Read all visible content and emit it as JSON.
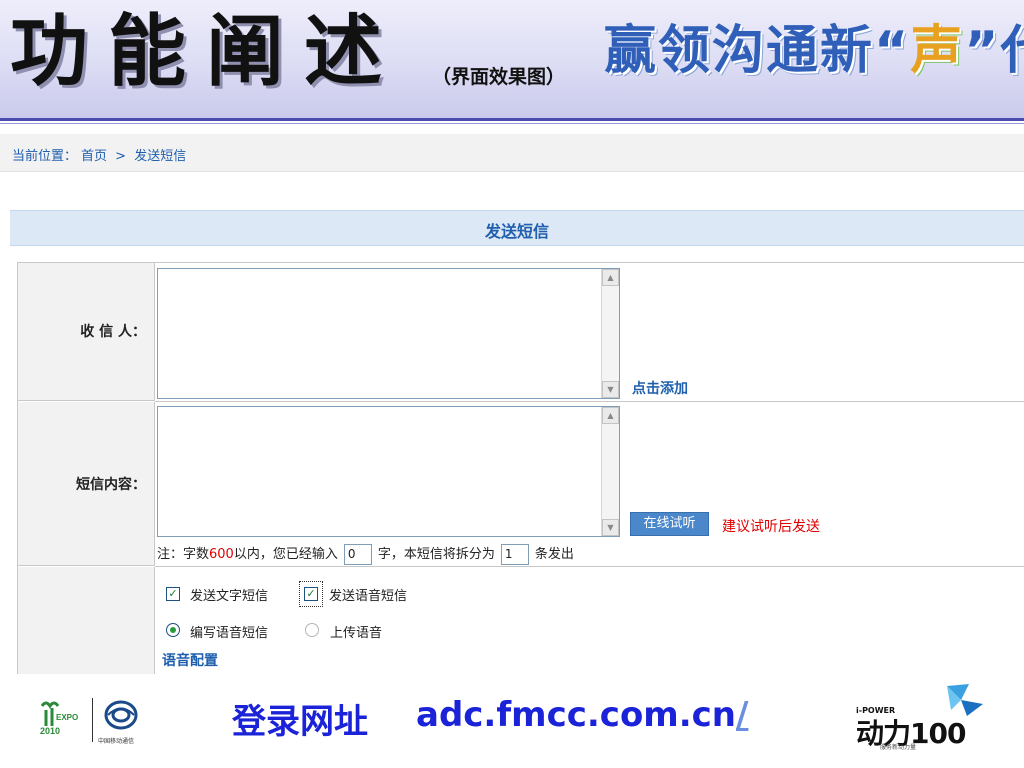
{
  "header": {
    "title": "功能阐述",
    "subtitle": "（界面效果图）",
    "slogan_pre": "赢领沟通新",
    "slogan_quote_open": "“",
    "slogan_highlight": "声",
    "slogan_quote_close": "”",
    "slogan_post": "代"
  },
  "breadcrumb": {
    "label": "当前位置：",
    "home": "首页",
    "separator": ">",
    "current": "发送短信"
  },
  "page_title": "发送短信",
  "form": {
    "recipients_label": "收 信 人：",
    "add_link": "点击添加",
    "content_label": "短信内容：",
    "listen_button": "在线试听",
    "listen_tip": "建议试听后发送",
    "note_prefix": "注：字数",
    "note_limit": "600",
    "note_mid": "以内，您已经输入",
    "chars_entered": "0",
    "note_mid2": "字，本短信将拆分为",
    "split_count": "1",
    "note_suffix": "条发出",
    "options": {
      "send_text_label": "发送文字短信",
      "send_text_checked": true,
      "send_voice_label": "发送语音短信",
      "send_voice_checked": true,
      "compose_voice_label": "编写语音短信",
      "compose_voice_selected": true,
      "upload_voice_label": "上传语音",
      "upload_voice_selected": false,
      "voice_config_link": "语音配置"
    }
  },
  "footer": {
    "expo_text": "EXPO 2010",
    "chinamobile_text": "中国移动通信",
    "login_label": "登录网址",
    "login_url": "adc.fmcc.com.cn",
    "login_url_suffix": "/",
    "power_small": "i-POWER",
    "power_main": "动力100",
    "power_tagline": "服务新动力量"
  },
  "colors": {
    "accent_blue": "#1f5fae",
    "title_band": "#dce8f5",
    "warning_red": "#e00000",
    "url_blue": "#1a23d8"
  }
}
